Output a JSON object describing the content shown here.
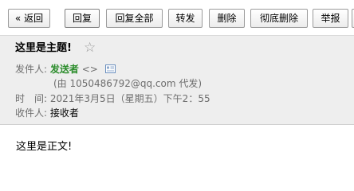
{
  "toolbar": {
    "back": "« 返回",
    "reply": "回复",
    "reply_all": "回复全部",
    "forward": "转发",
    "delete": "删除",
    "delete_forever": "彻底删除",
    "report": "举报"
  },
  "mail": {
    "subject": "这里是主题!",
    "from_label": "发件人:",
    "from_name": "发送者",
    "from_brackets": "<>",
    "via": "(由 1050486792@qq.com 代发)",
    "time_label": "时　间:",
    "time_value": "2021年3月5日（星期五）下午2：55",
    "to_label": "收件人:",
    "to_name": "接收者",
    "body": "这里是正文!"
  }
}
